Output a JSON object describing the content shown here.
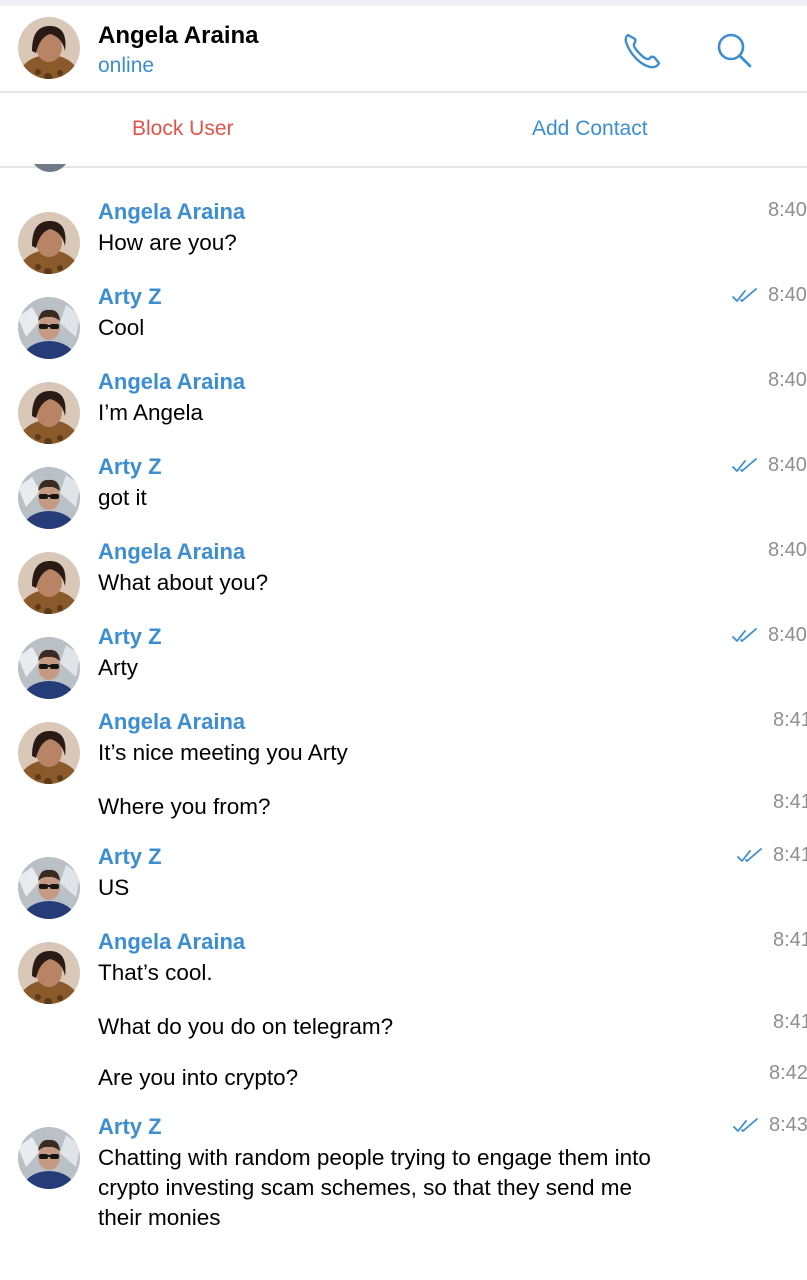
{
  "header": {
    "contact_name": "Angela Araina",
    "status": "online",
    "call_icon": "phone-icon",
    "search_icon": "search-icon"
  },
  "actions": {
    "block_label": "Block User",
    "add_label": "Add Contact"
  },
  "colors": {
    "accent": "#3d8ed1",
    "danger": "#e05447",
    "timestamp": "#8e8e93"
  },
  "messages": [
    {
      "sender": "Angela Araina",
      "text": "How are you?",
      "time": "8:40",
      "read": false
    },
    {
      "sender": "Arty Z",
      "text": "Cool",
      "time": "8:40",
      "read": true
    },
    {
      "sender": "Angela Araina",
      "text": "I’m Angela",
      "time": "8:40",
      "read": false
    },
    {
      "sender": "Arty Z",
      "text": "got it",
      "time": "8:40",
      "read": true
    },
    {
      "sender": "Angela Araina",
      "text": "What about you?",
      "time": "8:40",
      "read": false
    },
    {
      "sender": "Arty Z",
      "text": "Arty",
      "time": "8:40",
      "read": true
    },
    {
      "sender": "Angela Araina",
      "text": "It’s nice meeting you Arty",
      "time": "8:41",
      "read": false
    },
    {
      "sender": "",
      "text": "Where you from?",
      "time": "8:41",
      "read": false
    },
    {
      "sender": "Arty Z",
      "text": "US",
      "time": "8:41",
      "read": true
    },
    {
      "sender": "Angela Araina",
      "text": "That’s cool.",
      "time": "8:41",
      "read": false
    },
    {
      "sender": "",
      "text": "What do you do on telegram?",
      "time": "8:41",
      "read": false
    },
    {
      "sender": "",
      "text": "Are you into crypto?",
      "time": "8:42",
      "read": false
    },
    {
      "sender": "Arty Z",
      "text": "Chatting with random people trying to engage them into\ncrypto investing scam schemes, so that they send me\ntheir monies",
      "time": "8:43",
      "read": true
    }
  ]
}
